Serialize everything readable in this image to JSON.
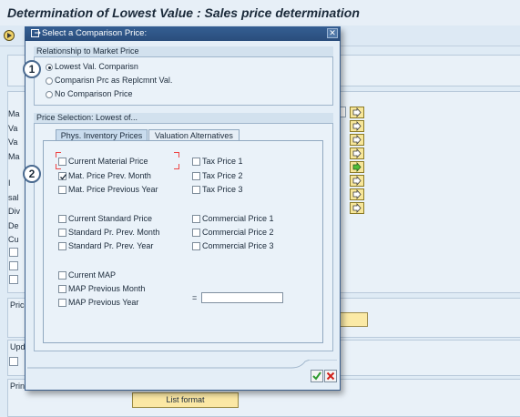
{
  "screen": {
    "title": "Determination of Lowest Value : Sales price determination",
    "bg_labels": [
      "Ma",
      "Va",
      "Va",
      "Ma",
      "I",
      "sal",
      "Div",
      "De",
      "Cu"
    ],
    "section_labels": [
      "Price",
      "Upd",
      "Print"
    ],
    "list_format_button": "List format"
  },
  "dialog": {
    "title": "Select a Comparison Price:",
    "close_icon": "close-icon",
    "market_group": {
      "title": "Relationship to Market Price",
      "options": [
        {
          "label": "Lowest Val. Comparisn",
          "selected": true
        },
        {
          "label": "Comparisn Prc as Replcmnt Val.",
          "selected": false
        },
        {
          "label": "No Comparison Price",
          "selected": false
        }
      ]
    },
    "price_group": {
      "title": "Price Selection: Lowest of...",
      "tabs": [
        {
          "label": "Phys. Inventory Prices",
          "active": true
        },
        {
          "label": "Valuation Alternatives",
          "active": false
        }
      ],
      "left_col": [
        {
          "label": "Current Material Price",
          "checked": false
        },
        {
          "label": "Mat. Price Prev. Month",
          "checked": true
        },
        {
          "label": "Mat. Price Previous Year",
          "checked": false
        },
        {
          "label": "Current Standard Price",
          "checked": false
        },
        {
          "label": "Standard Pr. Prev. Month",
          "checked": false
        },
        {
          "label": "Standard Pr. Prev. Year",
          "checked": false
        },
        {
          "label": "Current MAP",
          "checked": false
        },
        {
          "label": "MAP Previous Month",
          "checked": false
        },
        {
          "label": "MAP Previous Year",
          "checked": false
        }
      ],
      "right_col": [
        {
          "label": "Tax Price 1",
          "checked": false
        },
        {
          "label": "Tax Price 2",
          "checked": false
        },
        {
          "label": "Tax Price 3",
          "checked": false
        },
        {
          "label": "Commercial Price 1",
          "checked": false
        },
        {
          "label": "Commercial Price 2",
          "checked": false
        },
        {
          "label": "Commercial Price 3",
          "checked": false
        }
      ],
      "eq_sign": "=",
      "eq_value": ""
    },
    "callouts": [
      "1",
      "2"
    ]
  },
  "colors": {
    "dialog_title_bg": "#2f568a",
    "ok_green": "#2e9a2e",
    "cancel_red": "#d0201a"
  }
}
